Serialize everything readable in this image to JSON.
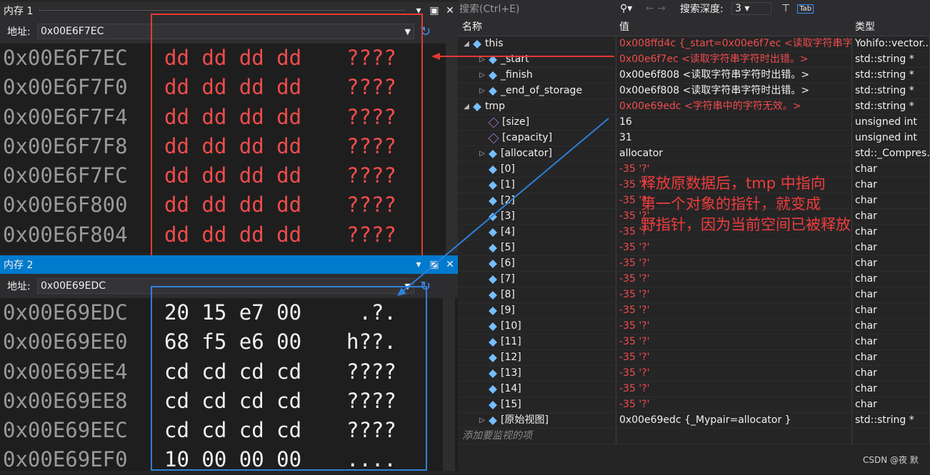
{
  "mem1": {
    "title": "内存 1",
    "address_label": "地址:",
    "address": "0x00E6F7EC",
    "rows": [
      {
        "addr": "0x00E6F7EC",
        "bytes": "dd dd dd dd",
        "ascii": "????"
      },
      {
        "addr": "0x00E6F7F0",
        "bytes": "dd dd dd dd",
        "ascii": "????"
      },
      {
        "addr": "0x00E6F7F4",
        "bytes": "dd dd dd dd",
        "ascii": "????"
      },
      {
        "addr": "0x00E6F7F8",
        "bytes": "dd dd dd dd",
        "ascii": "????"
      },
      {
        "addr": "0x00E6F7FC",
        "bytes": "dd dd dd dd",
        "ascii": "????"
      },
      {
        "addr": "0x00E6F800",
        "bytes": "dd dd dd dd",
        "ascii": "????"
      },
      {
        "addr": "0x00E6F804",
        "bytes": "dd dd dd dd",
        "ascii": "????"
      }
    ]
  },
  "mem2": {
    "title": "内存 2",
    "address_label": "地址:",
    "address": "0x00E69EDC",
    "rows": [
      {
        "addr": "0x00E69EDC",
        "bytes": "20 15 e7 00",
        "ascii": " .?."
      },
      {
        "addr": "0x00E69EE0",
        "bytes": "68 f5 e6 00",
        "ascii": "h??."
      },
      {
        "addr": "0x00E69EE4",
        "bytes": "cd cd cd cd",
        "ascii": "????"
      },
      {
        "addr": "0x00E69EE8",
        "bytes": "cd cd cd cd",
        "ascii": "????"
      },
      {
        "addr": "0x00E69EEC",
        "bytes": "cd cd cd cd",
        "ascii": "????"
      },
      {
        "addr": "0x00E69EF0",
        "bytes": "10 00 00 00",
        "ascii": "...."
      }
    ]
  },
  "watch": {
    "search_placeholder": "搜索(Ctrl+E)",
    "depth_label": "搜索深度:",
    "depth_value": "3",
    "headers": {
      "name": "名称",
      "value": "值",
      "type": "类型"
    },
    "rows": [
      {
        "name": "this",
        "value": "0x008ffd4c {_start=0x00e6f7ec <读取字符串字...",
        "type": "Yohifo::vector...",
        "red": true
      },
      {
        "name": "_start",
        "value": "0x00e6f7ec <读取字符串字符时出错。>",
        "type": "std::string *",
        "red": true
      },
      {
        "name": "_finish",
        "value": "0x00e6f808 <读取字符串字符时出错。>",
        "type": "std::string *",
        "red": false
      },
      {
        "name": "_end_of_storage",
        "value": "0x00e6f808 <读取字符串字符时出错。>",
        "type": "std::string *",
        "red": false
      },
      {
        "name": "tmp",
        "value": "0x00e69edc  <字符串中的字符无效。>",
        "type": "std::string *",
        "red": true
      },
      {
        "name": "[size]",
        "value": "16",
        "type": "unsigned int",
        "red": false
      },
      {
        "name": "[capacity]",
        "value": "31",
        "type": "unsigned int",
        "red": false
      },
      {
        "name": "[allocator]",
        "value": "allocator",
        "type": "std::_Compres...",
        "red": false
      },
      {
        "name": "[0]",
        "value": "-35 '?'",
        "type": "char",
        "red": true
      },
      {
        "name": "[1]",
        "value": "-35 '?'",
        "type": "char",
        "red": true
      },
      {
        "name": "[2]",
        "value": "-35 '?'",
        "type": "char",
        "red": true
      },
      {
        "name": "[3]",
        "value": "-35 '?'",
        "type": "char",
        "red": true
      },
      {
        "name": "[4]",
        "value": "-35 '?'",
        "type": "char",
        "red": true
      },
      {
        "name": "[5]",
        "value": "-35 '?'",
        "type": "char",
        "red": true
      },
      {
        "name": "[6]",
        "value": "-35 '?'",
        "type": "char",
        "red": true
      },
      {
        "name": "[7]",
        "value": "-35 '?'",
        "type": "char",
        "red": true
      },
      {
        "name": "[8]",
        "value": "-35 '?'",
        "type": "char",
        "red": true
      },
      {
        "name": "[9]",
        "value": "-35 '?'",
        "type": "char",
        "red": true
      },
      {
        "name": "[10]",
        "value": "-35 '?'",
        "type": "char",
        "red": true
      },
      {
        "name": "[11]",
        "value": "-35 '?'",
        "type": "char",
        "red": true
      },
      {
        "name": "[12]",
        "value": "-35 '?'",
        "type": "char",
        "red": true
      },
      {
        "name": "[13]",
        "value": "-35 '?'",
        "type": "char",
        "red": true
      },
      {
        "name": "[14]",
        "value": "-35 '?'",
        "type": "char",
        "red": true
      },
      {
        "name": "[15]",
        "value": "-35 '?'",
        "type": "char",
        "red": true
      },
      {
        "name": "[原始视图]",
        "value": "0x00e69edc {_Mypair=allocator }",
        "type": "std::string *",
        "red": false
      }
    ],
    "add_item_placeholder": "添加要监视的项"
  },
  "annotation": {
    "lines": [
      "释放原数据后，tmp 中指向",
      "第一个对象的指针，就变成",
      "野指针，因为当前空间已被释放"
    ]
  },
  "watermark": "CSDN @夜 默",
  "colors": {
    "annot_red": "#f03c3c",
    "mem1_box": "#e53935",
    "mem2_box": "#2f80d8",
    "error_red": "#f14c4c"
  }
}
